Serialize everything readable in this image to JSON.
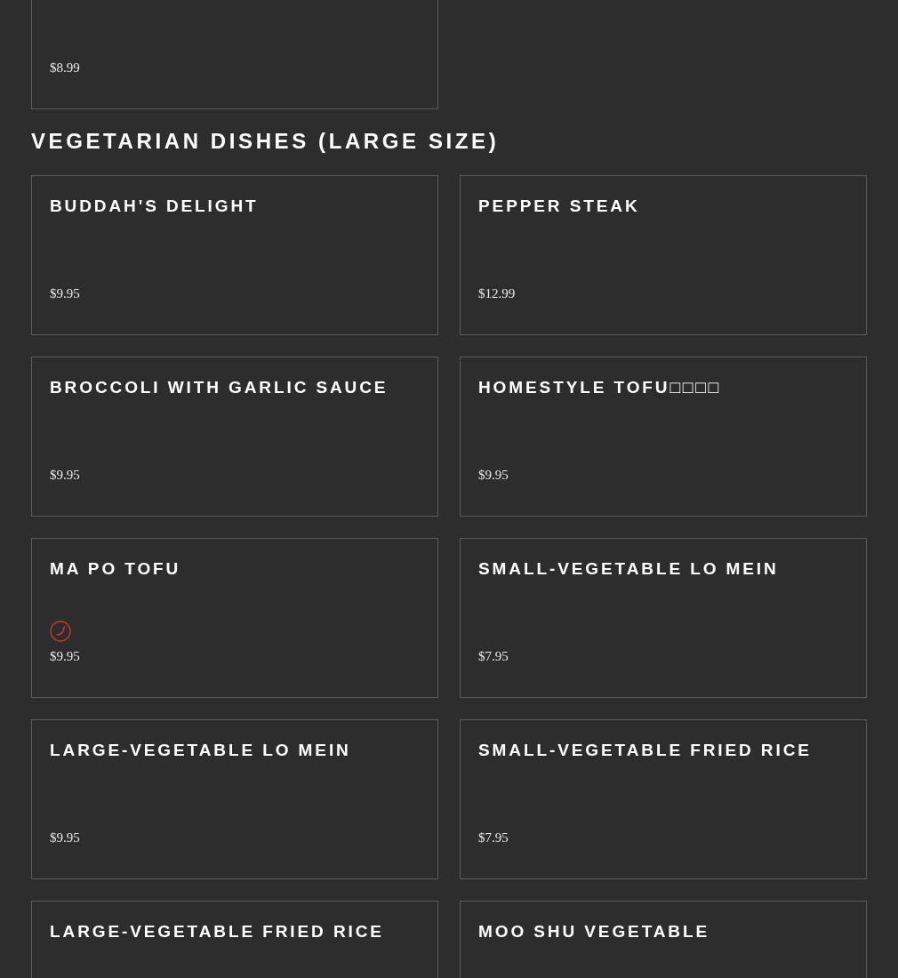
{
  "previous_section": {
    "items": [
      {
        "price": "$8.99",
        "spicy": false
      }
    ]
  },
  "section": {
    "title": "VEGETARIAN DISHES (LARGE SIZE)",
    "items": [
      {
        "name": "BUDDAH'S DELIGHT",
        "price": "$9.95",
        "spicy": false
      },
      {
        "name": "PEPPER STEAK",
        "price": "$12.99",
        "spicy": false
      },
      {
        "name": "BROCCOLI WITH GARLIC SAUCE",
        "price": "$9.95",
        "spicy": false
      },
      {
        "name": "HOMESTYLE TOFU□□□□",
        "price": "$9.95",
        "spicy": false
      },
      {
        "name": "MA PO TOFU",
        "price": "$9.95",
        "spicy": true
      },
      {
        "name": "SMALL-VEGETABLE LO MEIN",
        "price": "$7.95",
        "spicy": false
      },
      {
        "name": "LARGE-VEGETABLE LO MEIN",
        "price": "$9.95",
        "spicy": false
      },
      {
        "name": "SMALL-VEGETABLE FRIED RICE",
        "price": "$7.95",
        "spicy": false
      },
      {
        "name": "LARGE-VEGETABLE FRIED RICE",
        "spicy": false
      },
      {
        "name": "MOO SHU VEGETABLE",
        "spicy": false
      }
    ]
  }
}
